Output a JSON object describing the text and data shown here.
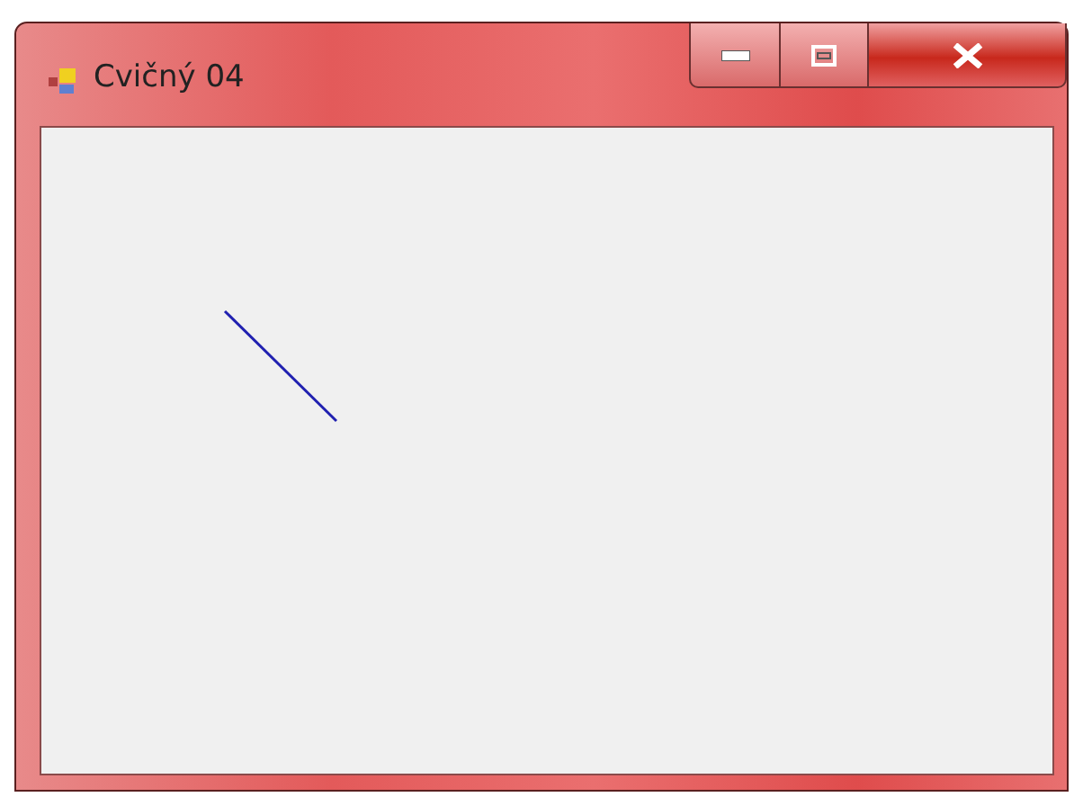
{
  "window": {
    "title": "Cvičný 04"
  }
}
